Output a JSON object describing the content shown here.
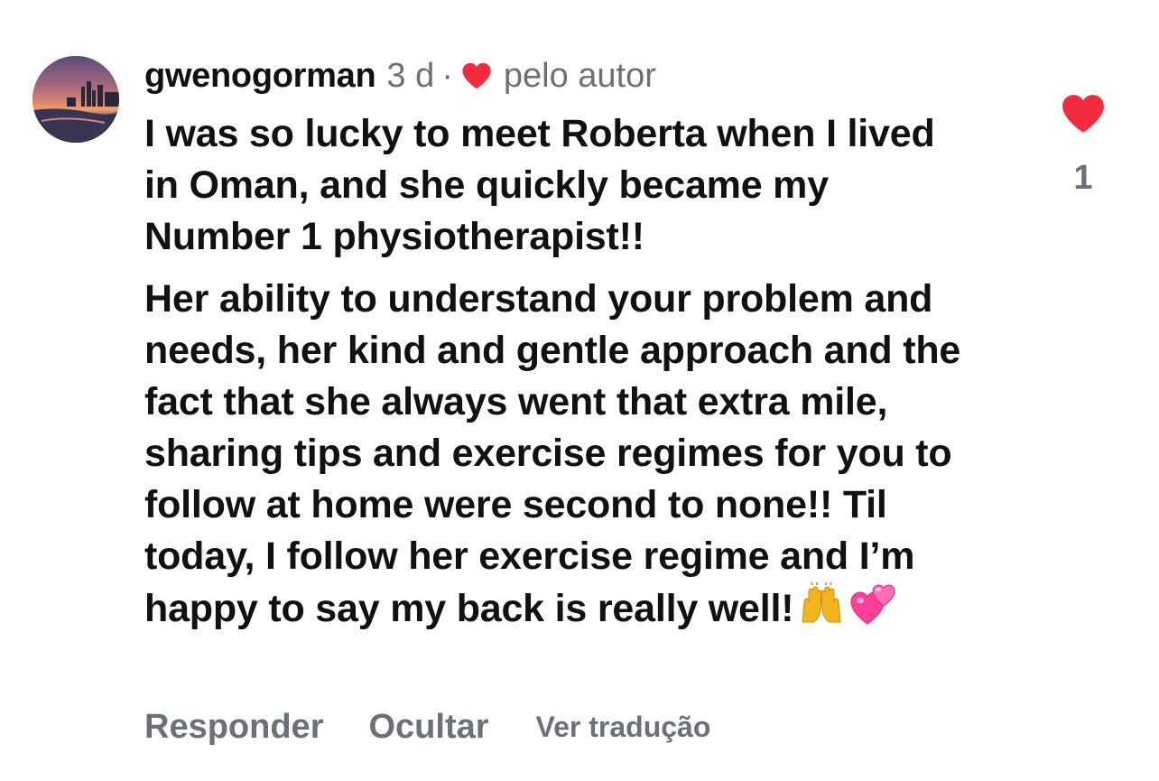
{
  "comment": {
    "username": "gwenogorman",
    "time_ago": "3 d",
    "separator": "·",
    "liked_by_author_label": "pelo autor",
    "paragraphs": [
      "I was so lucky to meet Roberta when I lived in Oman, and she quickly became my Number 1 physiotherapist!!",
      "Her ability to understand your problem and needs, her kind and gentle approach and the fact that she always went that extra mile, sharing tips and exercise regimes for you to follow at home were second to none!! Til today, I follow her exercise regime and I’m happy to say my back is really well!"
    ],
    "trailing_emojis": [
      "raising-hands-emoji",
      "two-hearts-emoji"
    ],
    "like_count": "1",
    "like_color": "#f22b3e"
  },
  "actions": {
    "reply": "Responder",
    "hide": "Ocultar",
    "translate": "Ver tradução"
  },
  "colors": {
    "text": "#111111",
    "muted": "#6b7079",
    "heart": "#f22b3e"
  }
}
